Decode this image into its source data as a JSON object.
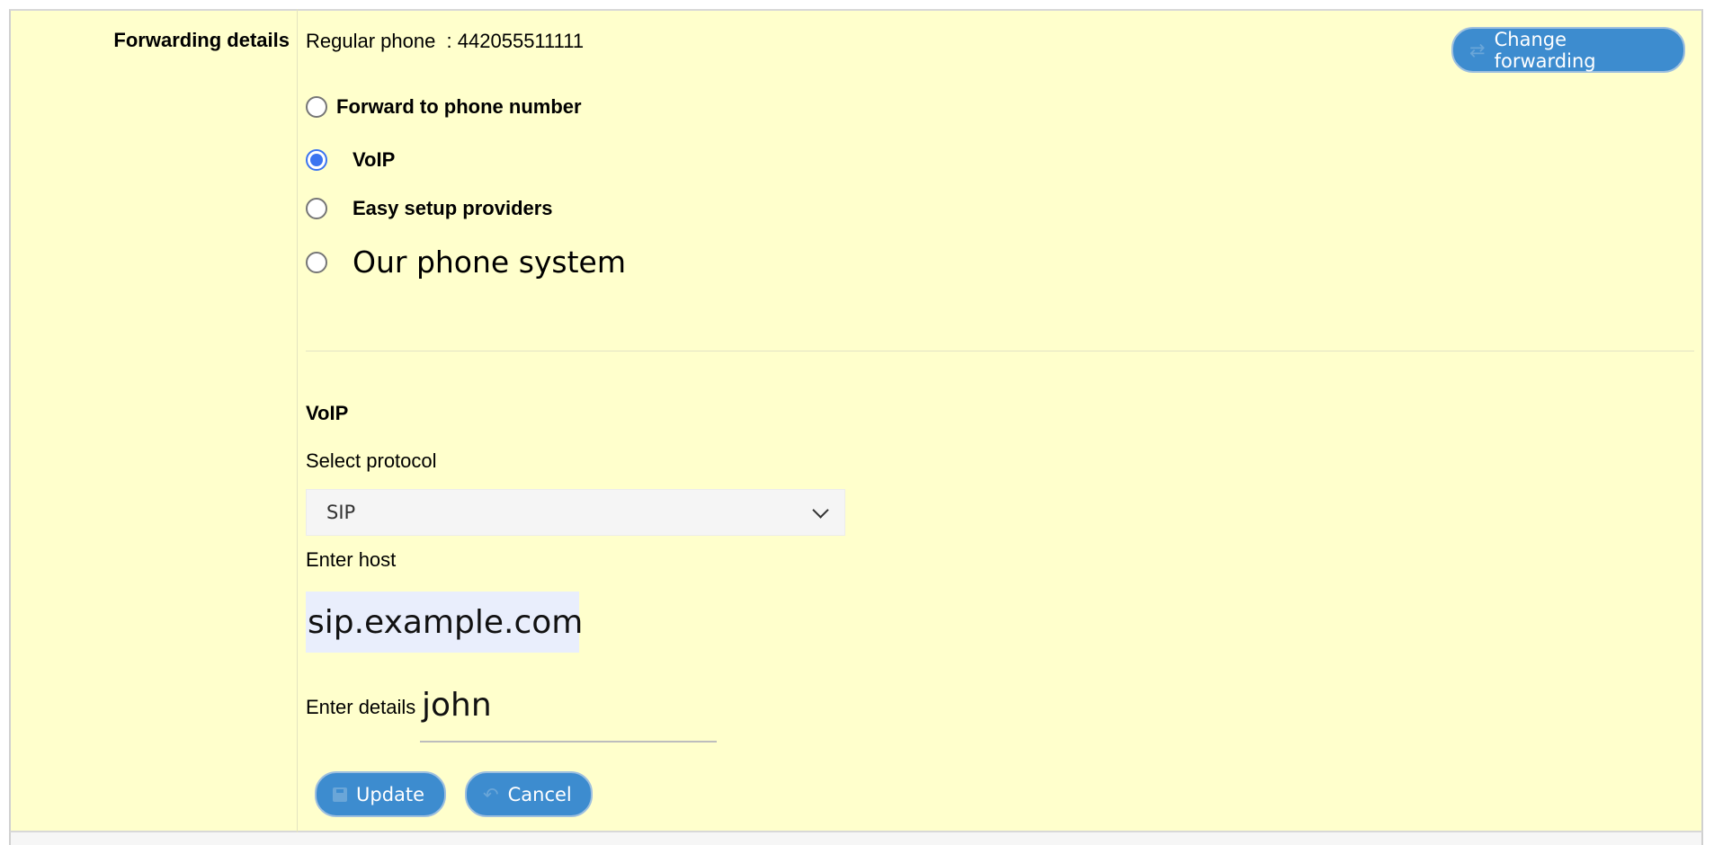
{
  "forwarding": {
    "row_label": "Forwarding details",
    "regular_phone": "Regular phone  : 442055511111",
    "change_button": "Change forwarding"
  },
  "options": {
    "forward_phone": "Forward to phone number",
    "voip": "VoIP",
    "easy_setup": "Easy setup providers",
    "our_system": "Our phone system",
    "selected": "VoIP"
  },
  "voip": {
    "section_title": "VoIP",
    "protocol_label": "Select protocol",
    "protocol_value": "SIP",
    "host_label": "Enter host",
    "host_value": "sip.example.com",
    "details_label": "Enter details",
    "details_value": "john"
  },
  "actions": {
    "update": "Update",
    "cancel": "Cancel"
  },
  "colors": {
    "panel_bg": "#ffffcc",
    "button_bg": "#3d8ccf",
    "radio_checked": "#3b74f0"
  }
}
